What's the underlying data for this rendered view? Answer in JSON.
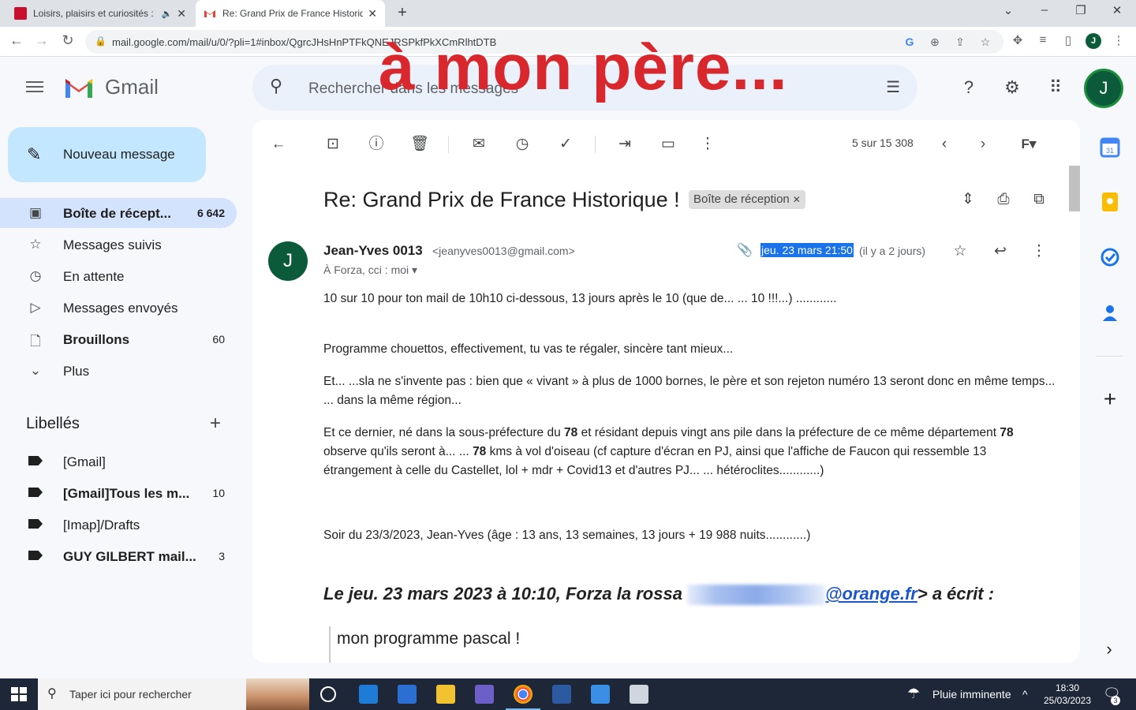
{
  "browser": {
    "tabs": [
      {
        "title": "Loisirs, plaisirs et curiosités :",
        "audio_icon": "🔈"
      },
      {
        "title": "Re: Grand Prix de France Historiq"
      }
    ],
    "url": "mail.google.com/mail/u/0/?pli=1#inbox/QgrcJHsHnPTFkQNEJRSPkfPkXCmRlhtDTB",
    "profile_initial": "J"
  },
  "overlay": {
    "text": "à mon père..."
  },
  "gmail": {
    "brand": "Gmail",
    "search_placeholder": "Rechercher dans les messages",
    "avatar_initial": "J",
    "compose_label": "Nouveau message",
    "nav": [
      {
        "label": "Boîte de récept...",
        "count": "6 642"
      },
      {
        "label": "Messages suivis",
        "count": ""
      },
      {
        "label": "En attente",
        "count": ""
      },
      {
        "label": "Messages envoyés",
        "count": ""
      },
      {
        "label": "Brouillons",
        "count": "60"
      },
      {
        "label": "Plus",
        "count": ""
      }
    ],
    "labels_heading": "Libellés",
    "labels": [
      {
        "label": "[Gmail]",
        "count": ""
      },
      {
        "label": "[Gmail]Tous les m...",
        "count": "10"
      },
      {
        "label": "[Imap]/Drafts",
        "count": ""
      },
      {
        "label": "GUY GILBERT mail...",
        "count": "3"
      }
    ]
  },
  "toolbar": {
    "pager": "5 sur 15 308"
  },
  "message": {
    "subject": "Re: Grand Prix de France Historique !",
    "label_chip": "Boîte de réception",
    "sender_initial": "J",
    "sender_name": "Jean-Yves 0013",
    "sender_email": "<jeanyves0013@gmail.com>",
    "recipients": "À Forza, cci : moi",
    "date": "jeu. 23 mars 21:50",
    "ago": "(il y a 2 jours)",
    "p1": "10 sur 10 pour ton mail de 10h10 ci-dessous, 13 jours après le 10 (que de... ... 10 !!!...) ............",
    "p2": "Programme chouettos, effectivement, tu vas te régaler, sincère tant mieux...",
    "p3": "Et... ...sla ne s'invente pas : bien que « vivant » à plus de 1000 bornes, le père et son rejeton numéro 13 seront donc en même temps... ... dans la même région...",
    "p4a": "Et ce dernier, né dans la sous-préfecture du ",
    "p4b": "78",
    "p4c": " et résidant depuis vingt ans pile dans la préfecture de ce même département ",
    "p4d": "78",
    "p4e": " observe qu'ils seront à... ... ",
    "p4f": "78",
    "p4g": " kms à vol d'oiseau (cf capture d'écran en PJ, ainsi que l'affiche de Faucon qui ressemble 13 étrangement à celle du Castellet, lol + mdr + Covid13 et d'autres PJ... ... hétéroclites............)",
    "p5": "Soir du 23/3/2023, Jean-Yves (âge : 13 ans, 13 semaines, 13 jours + 19 988 nuits............)",
    "quote_prefix": "Le jeu. 23 mars 2023 à 10:10, Forza la rossa ",
    "quote_link": "@orange.fr",
    "quote_suffix": "> a écrit :",
    "quote_text": "mon programme pascal !"
  },
  "taskbar": {
    "search_placeholder": "Taper ici pour rechercher",
    "weather": "Pluie imminente",
    "time": "18:30",
    "date": "25/03/2023",
    "notif_count": "3"
  },
  "colors": {
    "accent": "#1a73e8",
    "overlay": "#d8282d",
    "avatar": "#0b5a3a",
    "compose": "#c2e7ff",
    "selected": "#d3e3fd"
  }
}
